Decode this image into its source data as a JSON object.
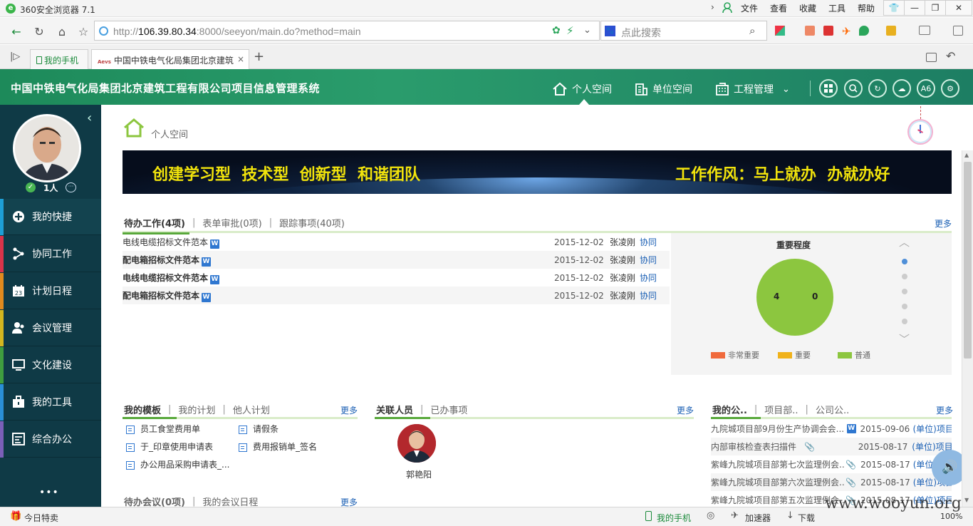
{
  "browser": {
    "title": "360安全浏览器 7.1",
    "menu": [
      "文件",
      "查看",
      "收藏",
      "工具",
      "帮助"
    ],
    "url_host": "106.39.80.34",
    "url_prefix": "http://",
    "url_rest": ":8000/seeyon/main.do?method=main",
    "search_placeholder": "点此搜索",
    "tabs": [
      {
        "label": "我的手机"
      },
      {
        "label": "中国中铁电气化局集团北京建筑"
      }
    ],
    "status": {
      "left": "今日特卖",
      "phone": "我的手机",
      "accelerator": "加速器",
      "download": "下载",
      "zoom": "100%"
    }
  },
  "app": {
    "system_name": "中国中铁电气化局集团北京建筑工程有限公司项目信息管理系统",
    "nav": [
      {
        "label": "个人空间"
      },
      {
        "label": "单位空间"
      },
      {
        "label": "工程管理"
      }
    ],
    "header_icons": {
      "font_size": "A6"
    },
    "user": {
      "online_count": "1人"
    },
    "sidebar": [
      {
        "label": "我的快捷",
        "color": "#1e9fd6"
      },
      {
        "label": "协同工作",
        "color": "#d9344a"
      },
      {
        "label": "计划日程",
        "color": "#e08a1e"
      },
      {
        "label": "会议管理",
        "color": "#d3b61f"
      },
      {
        "label": "文化建设",
        "color": "#3f9d3f"
      },
      {
        "label": "我的工具",
        "color": "#2a8fd6"
      },
      {
        "label": "综合办公",
        "color": "#7a5fb8"
      }
    ],
    "sidebar_more": "•••"
  },
  "page": {
    "title": "个人空间",
    "banner_left": "创建学习型  技术型  创新型  和谐团队",
    "banner_right": "工作作风：马上就办  办就办好",
    "todo": {
      "tabs": [
        "待办工作(4项)",
        "表单审批(0项)",
        "跟踪事项(40项)"
      ],
      "more": "更多",
      "rows": [
        {
          "title": "电线电缆招标文件范本",
          "date": "2015-12-02",
          "person": "张凌刚",
          "type": "协同",
          "bold": false
        },
        {
          "title": "配电箱招标文件范本",
          "date": "2015-12-02",
          "person": "张凌刚",
          "type": "协同",
          "bold": true
        },
        {
          "title": "电线电缆招标文件范本",
          "date": "2015-12-02",
          "person": "张凌刚",
          "type": "协同",
          "bold": true
        },
        {
          "title": "配电箱招标文件范本",
          "date": "2015-12-02",
          "person": "张凌刚",
          "type": "协同",
          "bold": true
        }
      ]
    },
    "importance": {
      "title": "重要程度",
      "labels": [
        "4",
        "0"
      ],
      "legend": [
        {
          "label": "非常重要",
          "color": "#f06a3c"
        },
        {
          "label": "重要",
          "color": "#f0b21a"
        },
        {
          "label": "普通",
          "color": "#8cc63f"
        }
      ],
      "pie_color": "#8cc63f"
    },
    "templates": {
      "tabs": [
        "我的模板",
        "我的计划",
        "他人计划"
      ],
      "more": "更多",
      "items": [
        "员工食堂费用单",
        "请假条",
        "于_印章使用申请表",
        "费用报销单_签名",
        "办公用品采购申请表_..."
      ]
    },
    "related": {
      "tabs": [
        "关联人员",
        "已办事项"
      ],
      "more": "更多",
      "person": "郭艳阳"
    },
    "meetings": {
      "tabs": [
        "待办会议(0项)",
        "我的会议日程"
      ],
      "more": "更多"
    },
    "announcements": {
      "tabs": [
        "我的公..",
        "项目部..",
        "公司公.."
      ],
      "more": "更多",
      "rows": [
        {
          "title": "九院城项目部9月份生产协调会会...",
          "date": "2015-09-06",
          "source": "(单位)项目",
          "icon": "word"
        },
        {
          "title": "内部审核检查表扫描件",
          "date": "2015-08-17",
          "source": "(单位)项目",
          "icon": "attach"
        },
        {
          "title": "紫峰九院城项目部第七次监理例会...",
          "date": "2015-08-17",
          "source": "(单位)项目",
          "icon": "attach"
        },
        {
          "title": "紫峰九院城项目部第六次监理例会...",
          "date": "2015-08-17",
          "source": "(单位)项目",
          "icon": "attach"
        },
        {
          "title": "紫峰九院城项目部第五次监理例会...",
          "date": "2015-08-17",
          "source": "(单位)项目",
          "icon": "attach"
        }
      ]
    }
  },
  "watermark": "www.wooyun.org"
}
